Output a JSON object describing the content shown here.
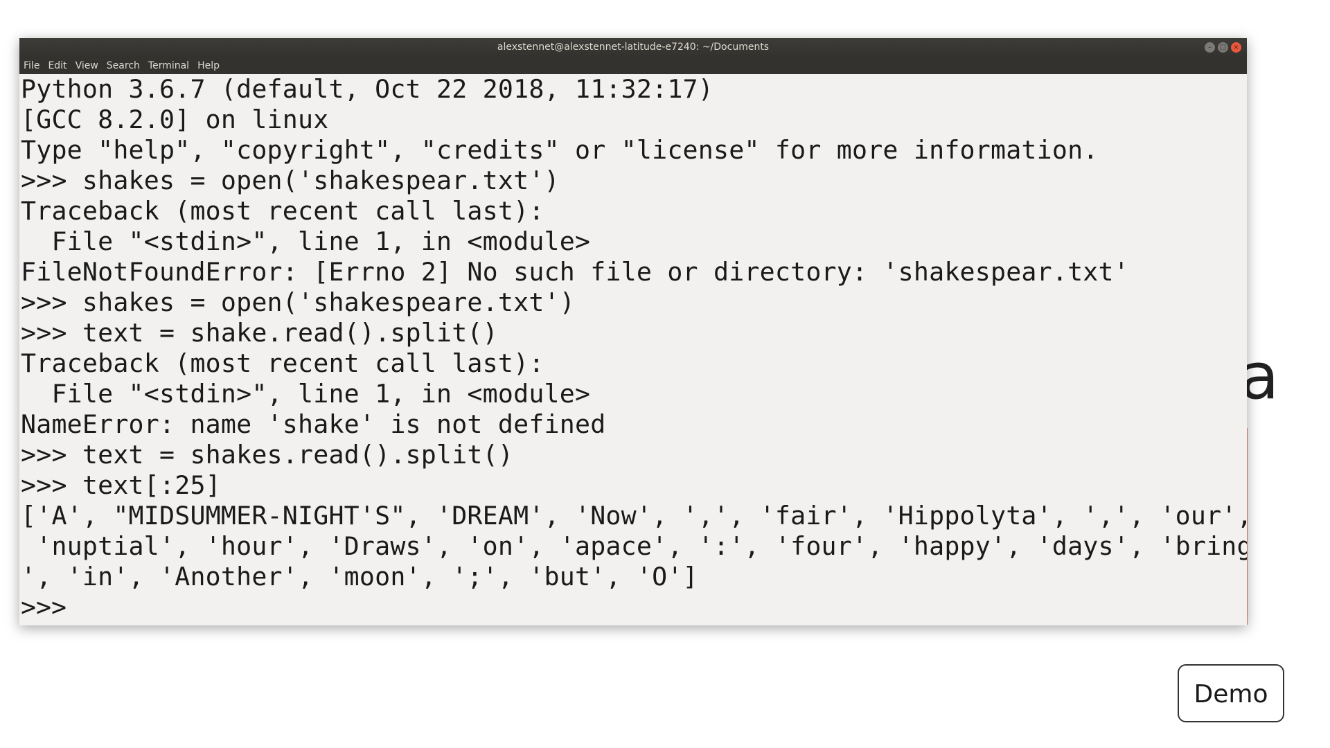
{
  "window": {
    "title": "alexstennet@alexstennet-latitude-e7240: ~/Documents",
    "controls": [
      "–",
      "□",
      "×"
    ]
  },
  "menu": [
    "File",
    "Edit",
    "View",
    "Search",
    "Terminal",
    "Help"
  ],
  "terminal": {
    "lines": [
      "Python 3.6.7 (default, Oct 22 2018, 11:32:17)",
      "[GCC 8.2.0] on linux",
      "Type \"help\", \"copyright\", \"credits\" or \"license\" for more information.",
      ">>> shakes = open('shakespear.txt')",
      "Traceback (most recent call last):",
      "  File \"<stdin>\", line 1, in <module>",
      "FileNotFoundError: [Errno 2] No such file or directory: 'shakespear.txt'",
      ">>> shakes = open('shakespeare.txt')",
      ">>> text = shake.read().split()",
      "Traceback (most recent call last):",
      "  File \"<stdin>\", line 1, in <module>",
      "NameError: name 'shake' is not defined",
      ">>> text = shakes.read().split()",
      ">>> text[:25]",
      "['A', \"MIDSUMMER-NIGHT'S\", 'DREAM', 'Now', ',', 'fair', 'Hippolyta', ',', 'our',",
      " 'nuptial', 'hour', 'Draws', 'on', 'apace', ':', 'four', 'happy', 'days', 'bring",
      "', 'in', 'Another', 'moon', ';', 'but', 'O']"
    ],
    "prompt": ">>> "
  },
  "background_letter": "a",
  "demo_button": "Demo",
  "colors": {
    "accent_bar": "#e4866f",
    "close_button": "#e9573e"
  }
}
